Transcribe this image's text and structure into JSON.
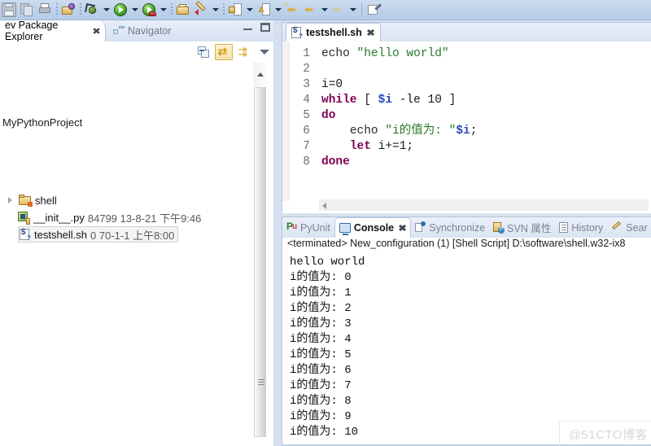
{
  "toolbar": {
    "items": [
      {
        "name": "save-button",
        "icon": "save-icon",
        "label": "Save"
      },
      {
        "name": "save-all-button",
        "icon": "save-all-icon",
        "label": "Save All"
      },
      {
        "name": "print-button",
        "icon": "print-icon",
        "label": "Print"
      },
      {
        "name": "new-wizard-button",
        "icon": "new-wizard-icon",
        "label": "New"
      },
      {
        "name": "debug-button",
        "icon": "debug-icon",
        "label": "Debug"
      },
      {
        "name": "run-button",
        "icon": "run-icon",
        "label": "Run"
      },
      {
        "name": "external-tools-button",
        "icon": "external-tools-icon",
        "label": "External Tools"
      },
      {
        "name": "open-resource-button",
        "icon": "open-folder-icon",
        "label": "Open Resource"
      },
      {
        "name": "pydev-run-button",
        "icon": "pen-icon",
        "label": "PyDev"
      },
      {
        "name": "last-edit-button",
        "icon": "last-edit-location-icon",
        "label": "Last Edit Location"
      },
      {
        "name": "next-annotation-button",
        "icon": "next-annotation-icon",
        "label": "Next Annotation"
      },
      {
        "name": "back-history-button",
        "icon": "back-arrow-star-icon",
        "label": "Back"
      },
      {
        "name": "back-button",
        "icon": "back-arrow-icon",
        "label": "Back"
      },
      {
        "name": "forward-button",
        "icon": "forward-arrow-icon",
        "label": "Forward"
      },
      {
        "name": "extract-button",
        "icon": "extract-icon",
        "label": "Extract"
      }
    ]
  },
  "left_view": {
    "tabs": [
      {
        "label": "ev Package Explorer",
        "active": true,
        "closable": true
      },
      {
        "label": "Navigator",
        "active": false,
        "closable": false
      }
    ],
    "window_buttons": [
      {
        "name": "minimize-button",
        "label": "Minimize"
      },
      {
        "name": "maximize-button",
        "label": "Maximize"
      }
    ],
    "view_toolbar": [
      {
        "name": "collapse-all-button",
        "icon": "collapse-all-icon",
        "label": "Collapse All",
        "toggled": false
      },
      {
        "name": "link-with-editor-button",
        "icon": "link-with-editor-icon",
        "label": "Link with Editor",
        "toggled": true
      },
      {
        "name": "filters-button",
        "icon": "filters-icon",
        "label": "Filters",
        "toggled": false
      },
      {
        "name": "view-menu-button",
        "icon": "chevron-down-icon",
        "label": "View Menu",
        "toggled": false
      }
    ],
    "project_label": "MyPythonProject",
    "tree": [
      {
        "label": "shell",
        "icon": "folder-icon",
        "expandable": true,
        "selected": false,
        "meta": "",
        "indent": 0
      },
      {
        "label": "__init__.py",
        "icon": "python-file-icon",
        "expandable": false,
        "selected": false,
        "meta": "84799  13-8-21 下午9:46",
        "indent": 1
      },
      {
        "label": "testshell.sh",
        "icon": "shell-file-icon",
        "expandable": false,
        "selected": true,
        "meta": "0  70-1-1 上午8:00",
        "indent": 1
      }
    ]
  },
  "editor": {
    "tab": {
      "label": "testshell.sh",
      "icon": "shell-file-icon",
      "active": true,
      "closable": true
    },
    "lines": [
      {
        "num": "1",
        "tokens": [
          {
            "t": "echo",
            "c": "cmd"
          },
          {
            "t": " ",
            "c": "pl"
          },
          {
            "t": "\"hello world\"",
            "c": "str"
          }
        ]
      },
      {
        "num": "2",
        "tokens": []
      },
      {
        "num": "3",
        "tokens": [
          {
            "t": "i=0",
            "c": "pl"
          }
        ]
      },
      {
        "num": "4",
        "tokens": [
          {
            "t": "while",
            "c": "kw"
          },
          {
            "t": " [ ",
            "c": "pl"
          },
          {
            "t": "$i",
            "c": "var"
          },
          {
            "t": " -le 10 ]",
            "c": "pl"
          }
        ]
      },
      {
        "num": "5",
        "tokens": [
          {
            "t": "do",
            "c": "kw"
          }
        ]
      },
      {
        "num": "6",
        "tokens": [
          {
            "t": "    ",
            "c": "pl"
          },
          {
            "t": "echo",
            "c": "cmd"
          },
          {
            "t": " ",
            "c": "pl"
          },
          {
            "t": "\"i的值为: \"",
            "c": "str"
          },
          {
            "t": "$i",
            "c": "var"
          },
          {
            "t": ";",
            "c": "pl"
          }
        ]
      },
      {
        "num": "7",
        "tokens": [
          {
            "t": "    ",
            "c": "pl"
          },
          {
            "t": "let",
            "c": "kw"
          },
          {
            "t": " i+=1;",
            "c": "pl"
          }
        ]
      },
      {
        "num": "8",
        "tokens": [
          {
            "t": "done",
            "c": "kw"
          }
        ]
      }
    ]
  },
  "console": {
    "tabs": [
      {
        "label": "PyUnit",
        "icon": "pyunit-icon",
        "active": false,
        "closable": false
      },
      {
        "label": "Console",
        "icon": "console-icon",
        "active": true,
        "closable": true
      },
      {
        "label": "Synchronize",
        "icon": "synchronize-icon",
        "active": false,
        "closable": false
      },
      {
        "label": "SVN 属性",
        "icon": "svn-icon",
        "active": false,
        "closable": false
      },
      {
        "label": "History",
        "icon": "history-icon",
        "active": false,
        "closable": false
      },
      {
        "label": "Sear",
        "icon": "search-icon",
        "active": false,
        "closable": false
      }
    ],
    "status_line": "<terminated> New_configuration (1) [Shell Script] D:\\software\\shell.w32-ix8",
    "output": [
      "hello world",
      "i的值为: 0",
      "i的值为: 1",
      "i的值为: 2",
      "i的值为: 3",
      "i的值为: 4",
      "i的值为: 5",
      "i的值为: 6",
      "i的值为: 7",
      "i的值为: 8",
      "i的值为: 9",
      "i的值为: 10"
    ]
  },
  "watermark": {
    "text": "@51CTO博客"
  },
  "colors": {
    "toolbar_bg": "#bed2ea",
    "window_bg": "#d6e0f0",
    "panel_bg": "#ffffff",
    "keyword": "#7f0055",
    "string": "#2a7a2a",
    "variable": "#2a4bbd",
    "line_number": "#6e6e6e",
    "tab_border": "#b7c6dc"
  }
}
